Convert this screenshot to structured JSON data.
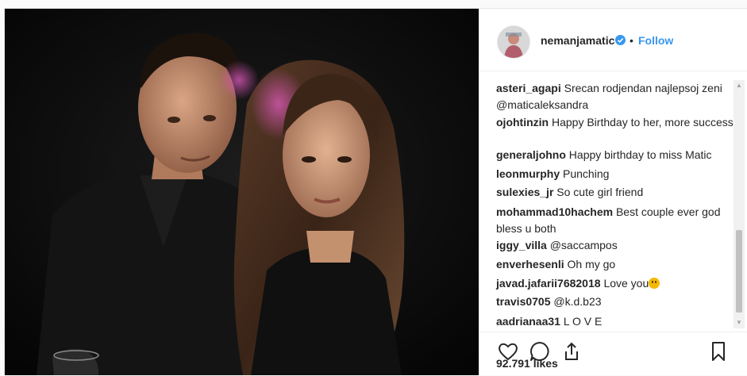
{
  "post": {
    "username": "nemanjamatic",
    "separator": "•",
    "follow_label": "Follow",
    "likes": "92.791 likes",
    "icons": {
      "verified": "verified-badge-icon",
      "like": "heart-icon",
      "comment": "comment-bubble-icon",
      "share": "share-icon",
      "save": "bookmark-icon"
    },
    "accent_color": "#3897f0"
  },
  "comments": [
    {
      "user": "asteri_agapi",
      "text": "Srecan rodjendan najlepsoj zeni @maticaleksandra"
    },
    {
      "user": "ojohtinzin",
      "text": "Happy Birthday to her, more success"
    },
    {
      "user": "generaljohno",
      "text": "Happy birthday to miss Matic"
    },
    {
      "user": "leonmurphy",
      "text": "Punching"
    },
    {
      "user": "sulexies_jr",
      "text": "So cute girl friend"
    },
    {
      "user": "mohammad10hachem",
      "text": "Best couple ever god bless u both"
    },
    {
      "user": "iggy_villa",
      "text": "@saccampos"
    },
    {
      "user": "enverhesenli",
      "text": "Oh my go"
    },
    {
      "user": "javad.jafarii7682018",
      "text": "Love you",
      "emoji": "blushing-face-emoji"
    },
    {
      "user": "travis0705",
      "text": "@k.d.b23"
    },
    {
      "user": "aadrianaa31",
      "text": "L O V E"
    }
  ]
}
